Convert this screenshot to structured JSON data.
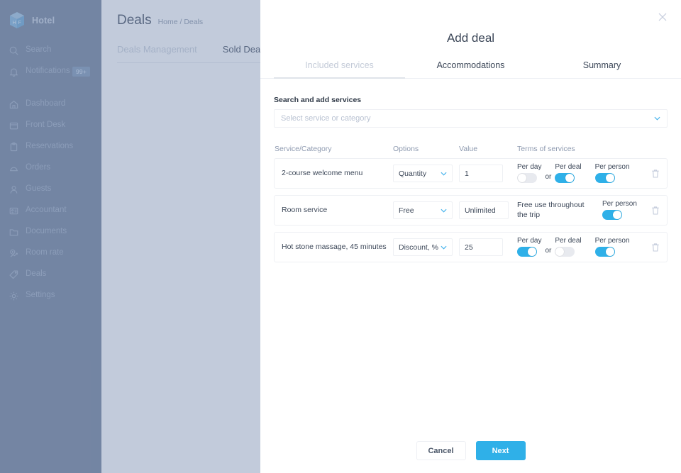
{
  "colors": {
    "sidebar_bg": "#70809a",
    "accent": "#2fb0e8",
    "overlay": "#9ca9bd",
    "toggle_off": "#e8eaef",
    "badge_bg": "#7d95b5"
  },
  "sidebar": {
    "brand": "Hotel",
    "logo_letters": "H F",
    "top_items": [
      {
        "label": "Search",
        "icon": "search-icon",
        "badge": null
      },
      {
        "label": "Notifications",
        "icon": "bell-icon",
        "badge": "99+"
      }
    ],
    "items": [
      {
        "label": "Dashboard",
        "icon": "home-icon"
      },
      {
        "label": "Front Desk",
        "icon": "desk-icon"
      },
      {
        "label": "Reservations",
        "icon": "clipboard-icon"
      },
      {
        "label": "Orders",
        "icon": "tray-icon"
      },
      {
        "label": "Guests",
        "icon": "user-icon"
      },
      {
        "label": "Accountant",
        "icon": "id-card-icon"
      },
      {
        "label": "Documents",
        "icon": "folder-icon"
      },
      {
        "label": "Room rate",
        "icon": "price-chart-icon"
      },
      {
        "label": "Deals",
        "icon": "tag-icon"
      },
      {
        "label": "Settings",
        "icon": "gear-icon"
      }
    ]
  },
  "background_page": {
    "title": "Deals",
    "breadcrumb": "Home / Deals",
    "tabs": [
      {
        "label": "Deals Management",
        "active": true
      },
      {
        "label": "Sold Deals",
        "active": false
      }
    ]
  },
  "modal": {
    "title": "Add deal",
    "close_icon": "close-icon",
    "tabs": [
      {
        "label": "Included services",
        "active": true
      },
      {
        "label": "Accommodations",
        "active": false
      },
      {
        "label": "Summary",
        "active": false
      }
    ],
    "search": {
      "label": "Search and add services",
      "placeholder": "Select service or category",
      "value": "",
      "chevron_icon": "chevron-down-icon"
    },
    "table": {
      "headers": {
        "service": "Service/Category",
        "options": "Options",
        "value": "Value",
        "terms": "Terms of services"
      },
      "rows": [
        {
          "service": "2-course welcome menu",
          "option": "Quantity",
          "value": "1",
          "free_note": null,
          "or_text": "or",
          "terms": [
            {
              "label": "Per day",
              "on": false
            },
            {
              "label": "Per deal",
              "on": true
            },
            {
              "label": "Per person",
              "on": true
            }
          ],
          "delete_icon": "trash-icon"
        },
        {
          "service": "Room service",
          "option": "Free",
          "value": "Unlimited",
          "free_note": "Free use throughout the trip",
          "or_text": null,
          "terms": [
            {
              "label": "Per person",
              "on": true
            }
          ],
          "delete_icon": "trash-icon"
        },
        {
          "service": "Hot stone massage, 45 minutes",
          "option": "Discount, %",
          "value": "25",
          "free_note": null,
          "or_text": "or",
          "terms": [
            {
              "label": "Per day",
              "on": true
            },
            {
              "label": "Per deal",
              "on": false
            },
            {
              "label": "Per person",
              "on": true
            }
          ],
          "delete_icon": "trash-icon"
        }
      ]
    },
    "footer": {
      "cancel_label": "Cancel",
      "next_label": "Next"
    }
  }
}
